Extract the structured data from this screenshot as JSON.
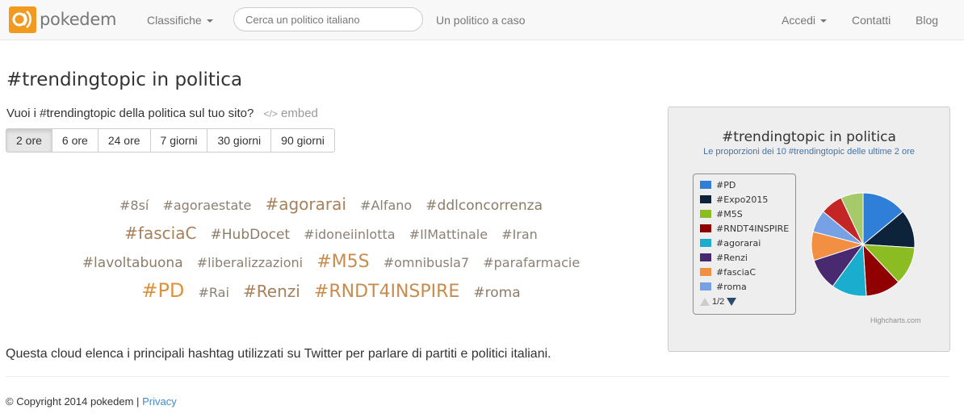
{
  "navbar": {
    "brand": "pokedem",
    "classifiche": "Classifiche",
    "search_placeholder": "Cerca un politico italiano",
    "random": "Un politico a caso",
    "accedi": "Accedi",
    "contatti": "Contatti",
    "blog": "Blog"
  },
  "page": {
    "title": "#trendingtopic in politica",
    "embed_prompt": "Vuoi i #trendingtopic della politica sul tuo sito?",
    "embed_code_glyph": "</>",
    "embed_label": "embed"
  },
  "time_filters": [
    "2 ore",
    "6 ore",
    "24 ore",
    "7 giorni",
    "30 giorni",
    "90 giorni"
  ],
  "time_filter_active": "2 ore",
  "cloud_rows": [
    [
      {
        "t": "#8sí",
        "s": 1
      },
      {
        "t": "#agoraestate",
        "s": 1
      },
      {
        "t": "#agorarai",
        "s": 3
      },
      {
        "t": "#Alfano",
        "s": 1
      },
      {
        "t": "#ddlconcorrenza",
        "s": 2
      }
    ],
    [
      {
        "t": "#fasciaC",
        "s": 3
      },
      {
        "t": "#HubDocet",
        "s": 2
      },
      {
        "t": "#idoneiinlotta",
        "s": 1
      },
      {
        "t": "#IlMattinale",
        "s": 1
      },
      {
        "t": "#Iran",
        "s": 1
      }
    ],
    [
      {
        "t": "#lavoltabuona",
        "s": 2
      },
      {
        "t": "#liberalizzazioni",
        "s": 1
      },
      {
        "t": "#M5S",
        "s": 4
      },
      {
        "t": "#omnibusla7",
        "s": 1
      },
      {
        "t": "#parafarmacie",
        "s": 1
      }
    ],
    [
      {
        "t": "#PD",
        "s": 5
      },
      {
        "t": "#Rai",
        "s": 1
      },
      {
        "t": "#Renzi",
        "s": 3
      },
      {
        "t": "#RNDT4INSPIRE",
        "s": 4
      },
      {
        "t": "#roma",
        "s": 2
      }
    ]
  ],
  "description": "Questa cloud elenca i principali hashtag utilizzati su Twitter per parlare di partiti e politici italiani.",
  "footer": {
    "copyright": "© Copyright 2014 pokedem |",
    "privacy": "Privacy"
  },
  "chart_data": {
    "type": "pie",
    "title": "#trendingtopic in politica",
    "subtitle": "Le proporzioni dei 10 #trendingtopic delle ultime 2 ore",
    "series": [
      {
        "name": "#PD",
        "value": 14,
        "color": "#2f7ed8"
      },
      {
        "name": "#Expo2015",
        "value": 12,
        "color": "#0d233a"
      },
      {
        "name": "#M5S",
        "value": 12,
        "color": "#8bbc21"
      },
      {
        "name": "#RNDT4INSPIRE",
        "value": 11,
        "color": "#910000"
      },
      {
        "name": "#agorarai",
        "value": 11,
        "color": "#1aadce"
      },
      {
        "name": "#Renzi",
        "value": 10,
        "color": "#492970"
      },
      {
        "name": "#fasciaC",
        "value": 9,
        "color": "#f28f43"
      },
      {
        "name": "#roma",
        "value": 7,
        "color": "#77a1e5"
      },
      {
        "name": "",
        "value": 7,
        "color": "#c42525"
      },
      {
        "name": "",
        "value": 7,
        "color": "#a6c96a"
      }
    ],
    "legend_page": "1/2",
    "legend_placement": "left",
    "credits": "Highcharts.com"
  }
}
